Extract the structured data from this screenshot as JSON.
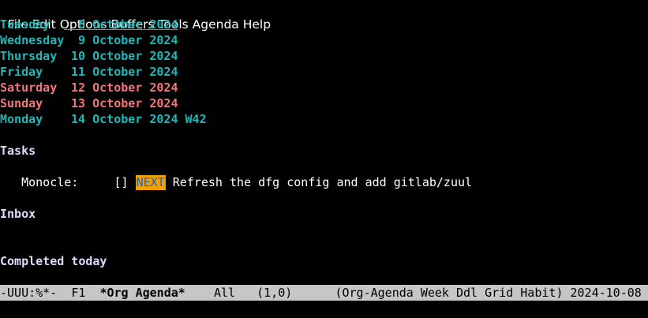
{
  "menu": [
    "File",
    "Edit",
    "Options",
    "Buffers",
    "Tools",
    "Agenda",
    "Help"
  ],
  "days": [
    {
      "day": "Tuesday",
      "date": "  8 October 2024",
      "week": "",
      "style": "today"
    },
    {
      "day": "Wednesday",
      "date": "  9 October 2024",
      "week": "",
      "style": "weekday"
    },
    {
      "day": "Thursday",
      "date": " 10 October 2024",
      "week": "",
      "style": "weekday"
    },
    {
      "day": "Friday",
      "date": " 11 October 2024",
      "week": "",
      "style": "weekday"
    },
    {
      "day": "Saturday",
      "date": " 12 October 2024",
      "week": "",
      "style": "weekend"
    },
    {
      "day": "Sunday",
      "date": " 13 October 2024",
      "week": "",
      "style": "weekend"
    },
    {
      "day": "Monday",
      "date": " 14 October 2024",
      "week": " W42",
      "style": "weekday"
    }
  ],
  "sections": {
    "tasks": "Tasks",
    "inbox": "Inbox",
    "completed": "Completed today"
  },
  "task": {
    "category": "Monocle:",
    "checkbox": "[]",
    "keyword": "NEXT",
    "title": "Refresh the dfg config and add gitlab/zuul"
  },
  "modeline": {
    "state": "-UUU:%*-",
    "frame": "F1",
    "buffer": "*Org Agenda*",
    "position": "All",
    "linecol": "(1,0)",
    "modes": "(Org-Agenda Week Ddl Grid Habit)",
    "date": "2024-10-08",
    "trailing": "T"
  },
  "colors": {
    "weekday": "#1fb8b8",
    "weekend": "#f07878",
    "heading": "#dcdcff",
    "next_bg": "#f0a000",
    "next_fg": "#1e60d0",
    "modeline_bg": "#c6c6c6"
  }
}
